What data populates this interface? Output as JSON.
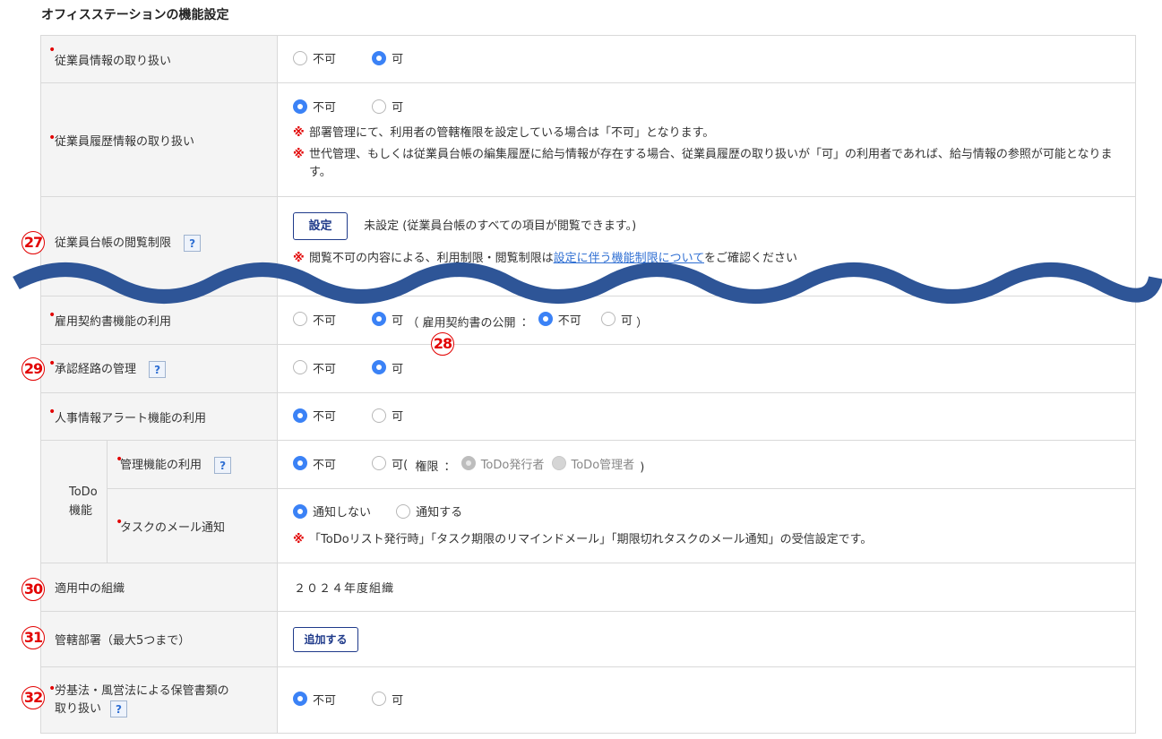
{
  "page": {
    "title": "オフィスステーションの機能設定"
  },
  "rows": {
    "employee_info": {
      "label": "従業員情報の取り扱い",
      "opt_no": "不可",
      "opt_yes": "可"
    },
    "employee_history": {
      "label": "従業員履歴情報の取り扱い",
      "opt_no": "不可",
      "opt_yes": "可",
      "note_mark": "※",
      "note1": "部署管理にて、利用者の管轄権限を設定している場合は「不可」となります。",
      "note2": "世代管理、もしくは従業員台帳の編集履歴に給与情報が存在する場合、従業員履歴の取り扱いが「可」の利用者であれば、給与情報の参照が可能となります。"
    },
    "ledger_view": {
      "label": "従業員台帳の閲覧制限",
      "button": "設定",
      "status": "未設定 (従業員台帳のすべての項目が閲覧できます。)",
      "note_mark": "※",
      "note_before": "閲覧不可の内容による、利用制限・閲覧制限は",
      "note_link": "設定に伴う機能制限について",
      "note_after": "をご確認ください"
    },
    "employment_contract": {
      "label": "雇用契約書機能の利用",
      "opt_no": "不可",
      "opt_yes": "可",
      "paren_open": "（",
      "sub_label": "雇用契約書の公開",
      "colon": "：",
      "sub_no": "不可",
      "sub_yes": "可",
      "paren_close": "）"
    },
    "approval_route": {
      "label": "承認経路の管理",
      "opt_no": "不可",
      "opt_yes": "可"
    },
    "hr_alert": {
      "label": "人事情報アラート機能の利用",
      "opt_no": "不可",
      "opt_yes": "可"
    },
    "todo": {
      "group_label_1": "ToDo",
      "group_label_2": "機能",
      "manage": {
        "label": "管理機能の利用",
        "opt_no": "不可",
        "opt_yes_prefix": "可(",
        "perm_label": "権限",
        "colon": "：",
        "perm1": "ToDo発行者",
        "perm2": "ToDo管理者",
        "paren_close": ")"
      },
      "mail": {
        "label": "タスクのメール通知",
        "opt_no": "通知しない",
        "opt_yes": "通知する",
        "note_mark": "※",
        "note": "「ToDoリスト発行時」「タスク期限のリマインドメール」「期限切れタスクのメール通知」の受信設定です。"
      }
    },
    "active_org": {
      "label": "適用中の組織",
      "value": "２０２４年度組織"
    },
    "departments": {
      "label": "管轄部署（最大5つまで）",
      "button": "追加する"
    },
    "labor_docs": {
      "label_line1": "労基法・風営法による保管書類の",
      "label_line2": "取り扱い",
      "opt_no": "不可",
      "opt_yes": "可"
    }
  },
  "help_glyph": "?",
  "required_mark": "•",
  "markers": [
    "27",
    "28",
    "29",
    "30",
    "31",
    "32"
  ],
  "colors": {
    "accent": "#3b82f6",
    "required": "#e20000",
    "wave": "#2e5597",
    "button": "#1f3a8a"
  }
}
